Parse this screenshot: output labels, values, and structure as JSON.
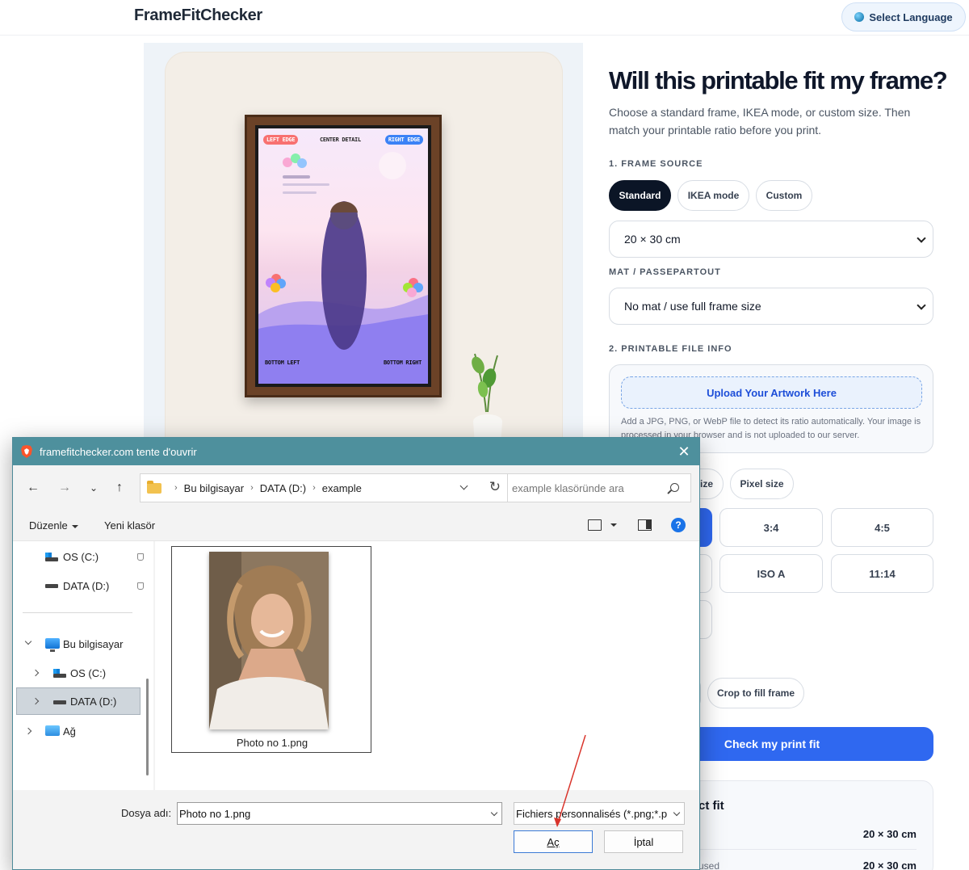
{
  "header": {
    "logo": "FrameFitChecker",
    "language_button": "Select Language"
  },
  "preview": {
    "tags": {
      "left_edge": "LEFT EDGE",
      "center_detail": "CENTER DETAIL",
      "right_edge": "RIGHT EDGE",
      "bottom_left": "BOTTOM LEFT",
      "bottom_right": "BOTTOM RIGHT"
    }
  },
  "form": {
    "title": "Will this printable fit my frame?",
    "subtitle": "Choose a standard frame, IKEA mode, or custom size. Then match your printable ratio before you print.",
    "section_frame_source": "1. FRAME SOURCE",
    "frame_source_options": [
      "Standard",
      "IKEA mode",
      "Custom"
    ],
    "frame_size_value": "20 × 30 cm",
    "section_mat": "MAT / PASSEPARTOUT",
    "mat_value": "No mat / use full frame size",
    "section_printable": "2. PRINTABLE FILE INFO",
    "upload_button": "Upload Your Artwork Here",
    "upload_help": "Add a JPG, PNG, or WebP file to detect its ratio automatically. Your image is processed in your browser and is not uploaded to our server.",
    "size_mode_partial": "ize",
    "size_mode_pixel": "Pixel size",
    "ratios": [
      "3:4",
      "4:5",
      "ISO A",
      "11:14"
    ],
    "fit_option": "Crop to fill frame",
    "check_button": "Check my print fit",
    "result_title_partial": "ct fit",
    "result_value_1": "20 × 30 cm",
    "result_value_2": "20 × 30 cm",
    "result_label_2_partial": "used"
  },
  "dialog": {
    "title": "framefitchecker.com tente d'ouvrir",
    "breadcrumb": [
      "Bu bilgisayar",
      "DATA (D:)",
      "example"
    ],
    "search_placeholder": "example klasöründe ara",
    "toolbar_organize": "Düzenle",
    "toolbar_new_folder": "Yeni klasör",
    "sidebar": {
      "pinned_os": "OS (C:)",
      "pinned_data": "DATA (D:)",
      "this_pc": "Bu bilgisayar",
      "os": "OS (C:)",
      "data": "DATA (D:)",
      "network": "Ağ"
    },
    "file": {
      "name": "Photo no 1.png"
    },
    "filename_label": "Dosya adı:",
    "filename_value": "Photo no 1.png",
    "filter_value": "Fichiers personnalisés (*.png;*.p",
    "open_button": "Aç",
    "cancel_button": "İptal"
  }
}
